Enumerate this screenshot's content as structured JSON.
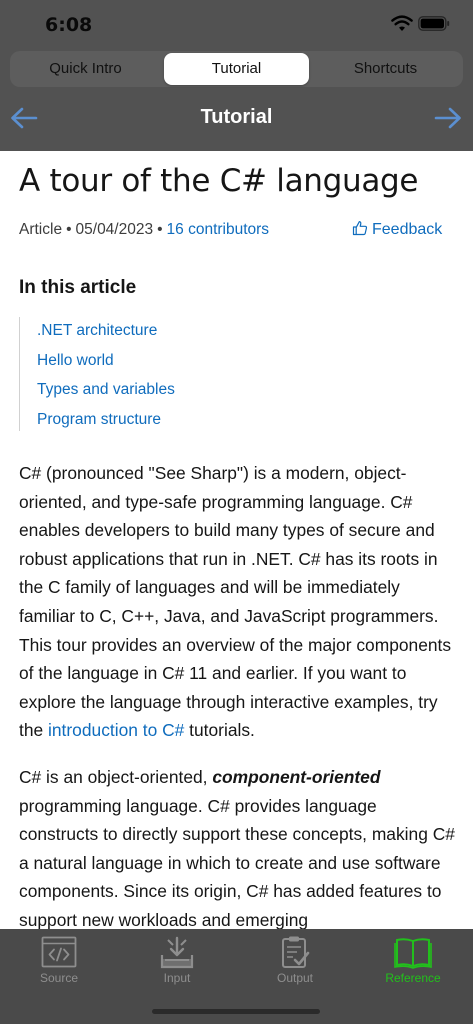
{
  "status_bar": {
    "time": "6:08",
    "icons": [
      "wifi-icon",
      "battery-icon"
    ]
  },
  "segments": [
    {
      "label": "Quick Intro",
      "active": false
    },
    {
      "label": "Tutorial",
      "active": true
    },
    {
      "label": "Shortcuts",
      "active": false
    }
  ],
  "navbar": {
    "title": "Tutorial",
    "left_icon": "arrow-left-icon",
    "right_icon": "arrow-right-icon"
  },
  "article": {
    "title": "A tour of the C# language",
    "meta": {
      "type": "Article",
      "date": "05/04/2023",
      "contributors": "16 contributors"
    },
    "feedback": "Feedback",
    "toc_heading": "In this article",
    "toc": [
      ".NET architecture",
      "Hello world",
      "Types and variables",
      "Program structure"
    ],
    "p1_before": "C# (pronounced \"See Sharp\") is a modern, object-oriented, and type-safe programming language. C# enables developers to build many types of secure and robust applications that run in .NET. C# has its roots in the C family of languages and will be immediately familiar to C, C++, Java, and JavaScript programmers. This tour provides an overview of the major components of the language in C# 11 and earlier. If you want to explore the language through interactive examples, try the ",
    "p1_link": "introduction to C#",
    "p1_after": " tutorials.",
    "p2_before": "C# is an object-oriented, ",
    "p2_em": "component-oriented",
    "p2_after": " programming language. C# provides language constructs to directly support these concepts, making C# a natural language in which to create and use software components. Since its origin, C# has added features to support new workloads and emerging"
  },
  "tabs": [
    {
      "label": "Source",
      "icon": "code-icon",
      "active": false
    },
    {
      "label": "Input",
      "icon": "input-icon",
      "active": false
    },
    {
      "label": "Output",
      "icon": "output-icon",
      "active": false
    },
    {
      "label": "Reference",
      "icon": "book-icon",
      "active": true
    }
  ],
  "colors": {
    "accent": "#22c01c",
    "link": "#0f6cbd",
    "chrome": "#525252",
    "tabbar": "#4a4a4a"
  }
}
